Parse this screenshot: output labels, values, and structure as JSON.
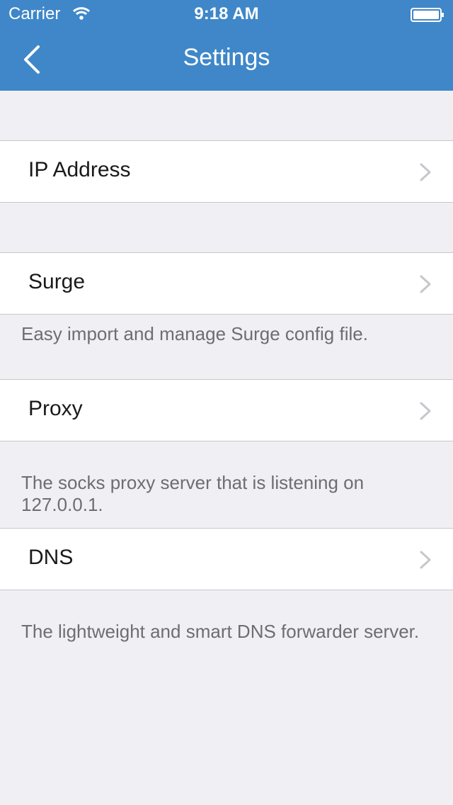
{
  "status_bar": {
    "carrier": "Carrier",
    "time": "9:18 AM"
  },
  "nav": {
    "title": "Settings"
  },
  "cells": [
    {
      "label": "IP Address"
    },
    {
      "label": "Surge",
      "footer": "Easy import and manage Surge config file."
    },
    {
      "label": "Proxy",
      "footer": "The socks proxy server that is listening on 127.0.0.1."
    },
    {
      "label": "DNS",
      "footer": "The lightweight and smart DNS forwarder server."
    }
  ],
  "colors": {
    "accent": "#3F87C8",
    "background": "#EFEFF4"
  },
  "icons": [
    "wifi-icon",
    "battery-icon",
    "back-chevron-icon",
    "chevron-right-icon"
  ]
}
